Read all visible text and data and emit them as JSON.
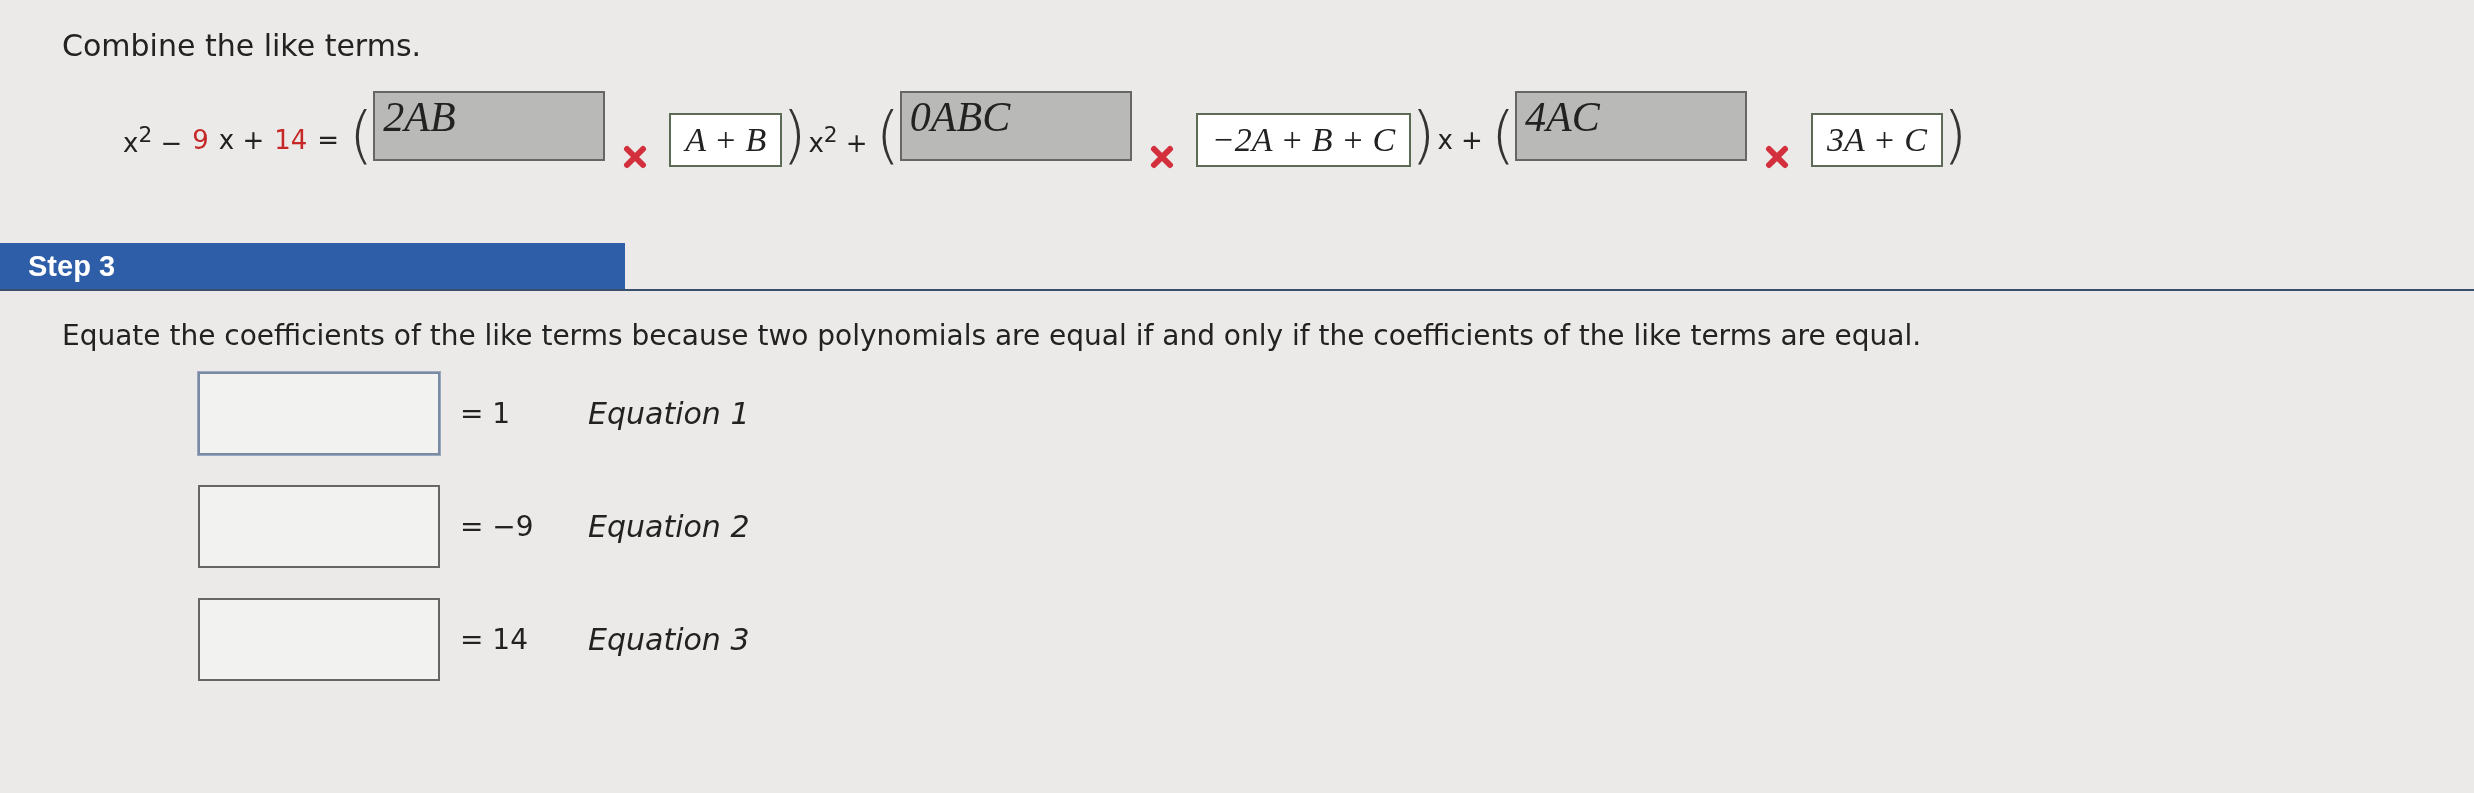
{
  "instruction": "Combine the like terms.",
  "equation": {
    "lhs": [
      {
        "text": "x$^{2}$ −",
        "highlight": false
      },
      {
        "text": "9",
        "highlight": true
      },
      {
        "text": "x +",
        "highlight": false
      },
      {
        "text": "14",
        "highlight": true
      },
      {
        "text": "=",
        "highlight": false
      }
    ],
    "groups": [
      {
        "open": "(",
        "answer": "2AB",
        "disabled": true,
        "correct": false,
        "factor": "A + B",
        "close": ")",
        "suffix": "x$^{2}$ +"
      },
      {
        "open": "(",
        "answer": "0ABC",
        "disabled": true,
        "correct": false,
        "factor": "−2A + B + C",
        "close": ")",
        "suffix": "x +"
      },
      {
        "open": "(",
        "answer": "4AC",
        "disabled": true,
        "correct": false,
        "factor": "3A + C",
        "close": ")"
      }
    ]
  },
  "step": {
    "title": "Step 3",
    "text": "Equate the coefficients of the like terms because two polynomials are equal if and only if the coefficients of the like terms are equal.",
    "equations": [
      {
        "rhs": "= 1",
        "label": "Equation 1",
        "focused": true
      },
      {
        "rhs": "= −9",
        "label": "Equation 2",
        "focused": false
      },
      {
        "rhs": "= 14",
        "label": "Equation 3",
        "focused": false
      }
    ]
  }
}
